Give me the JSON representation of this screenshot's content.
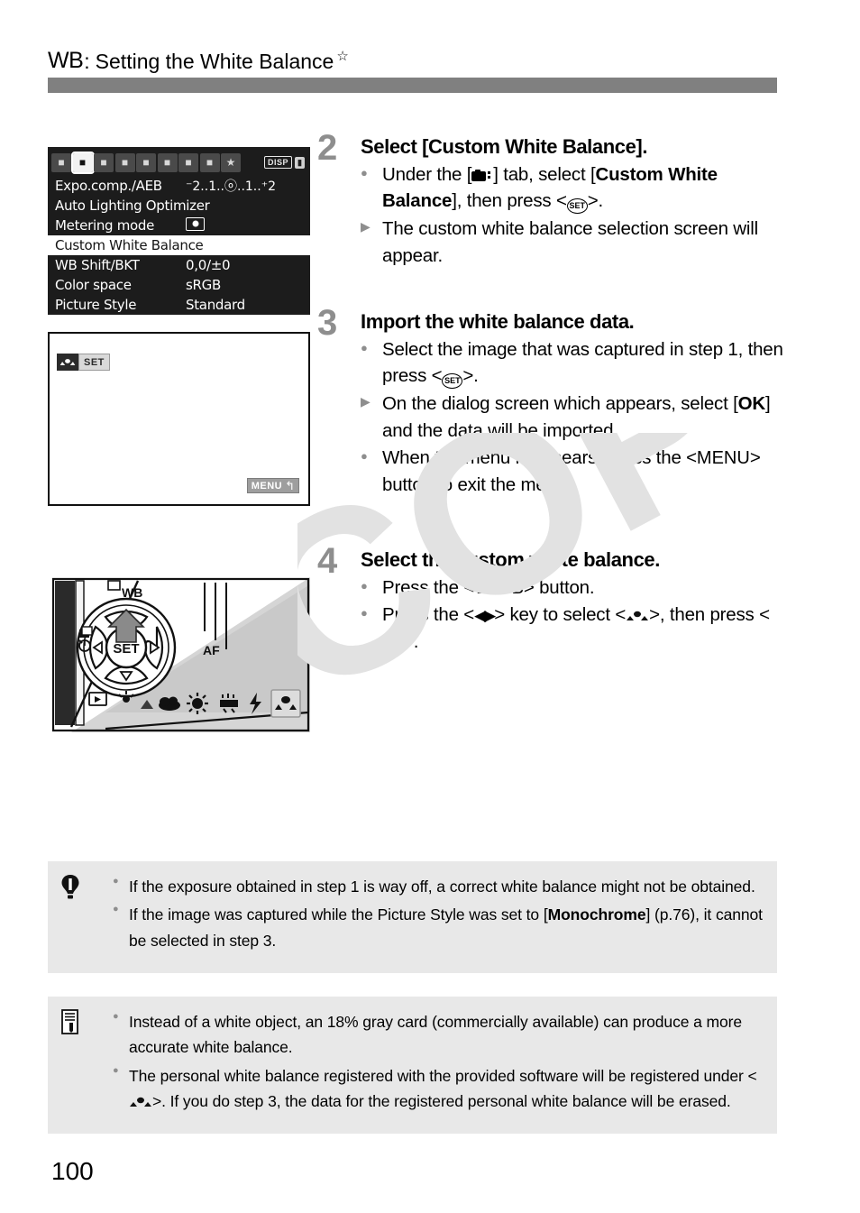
{
  "header": {
    "wb_symbol": "WB",
    "colon": ":",
    "title": "Setting the White Balance",
    "star": "☆",
    "bar_color": "#808080"
  },
  "menu_figure": {
    "name": "camera-menu-screenshot",
    "tabs": [
      {
        "name": "shoot-tab-1",
        "glyph": "■",
        "active": false
      },
      {
        "name": "shoot-tab-2",
        "glyph": "■",
        "active": true
      },
      {
        "name": "shoot-tab-3",
        "glyph": "■",
        "active": false
      },
      {
        "name": "playback-tab-1",
        "glyph": "■",
        "active": false
      },
      {
        "name": "playback-tab-2",
        "glyph": "■",
        "active": false
      },
      {
        "name": "setup-tab-1",
        "glyph": "■",
        "active": false
      },
      {
        "name": "setup-tab-2",
        "glyph": "■",
        "active": false
      },
      {
        "name": "setup-tab-3",
        "glyph": "■",
        "active": false
      },
      {
        "name": "my-menu-tab",
        "glyph": "★",
        "active": false
      }
    ],
    "disp_badge": "DISP",
    "lv_badge": "⬛",
    "rows": [
      {
        "label": "Expo.comp./AEB",
        "value": "⁻2..1..ⓞ..1..⁺2",
        "type": "scale",
        "selected": false
      },
      {
        "label": "Auto Lighting Optimizer",
        "value": "",
        "type": "plain",
        "selected": false
      },
      {
        "label": "Metering mode",
        "value": "",
        "type": "metering",
        "selected": false
      },
      {
        "label": "Custom White Balance",
        "value": "",
        "type": "plain",
        "selected": true
      },
      {
        "label": "WB Shift/BKT",
        "value": "0,0/±0",
        "type": "plain",
        "selected": false
      },
      {
        "label": "Color space",
        "value": "sRGB",
        "type": "plain",
        "selected": false
      },
      {
        "label": "Picture Style",
        "value": "Standard",
        "type": "plain",
        "selected": false
      }
    ]
  },
  "screen_figure": {
    "name": "custom-wb-selection-screen",
    "set_badge": "SET",
    "menu_badge": "MENU",
    "return_glyph": "↰"
  },
  "camera_figure": {
    "name": "camera-back-controls-diagram",
    "wb_label": "WB",
    "af_label": "AF",
    "set_label": "SET",
    "wb_icons": [
      {
        "name": "wb-shade-icon"
      },
      {
        "name": "wb-cloudy-icon"
      },
      {
        "name": "wb-daylight-icon"
      },
      {
        "name": "wb-tungsten-icon"
      },
      {
        "name": "wb-flash-icon"
      },
      {
        "name": "wb-custom-icon",
        "selected": true
      }
    ]
  },
  "steps": [
    {
      "number": "2",
      "title": "Select [Custom White Balance].",
      "bullets": [
        {
          "mark": "dot",
          "segments": [
            {
              "t": "Under the [",
              "b": false
            },
            {
              "t": "@CAMTAB@",
              "b": false
            },
            {
              "t": "] tab, select [",
              "b": false
            },
            {
              "t": "Custom White Balance",
              "b": true
            },
            {
              "t": "], then press <",
              "b": false
            },
            {
              "t": "@SET@",
              "b": false
            },
            {
              "t": ">.",
              "b": false
            }
          ]
        },
        {
          "mark": "tri",
          "segments": [
            {
              "t": "The custom white balance selection screen will appear.",
              "b": false
            }
          ]
        }
      ]
    },
    {
      "number": "3",
      "title": "Import the white balance data.",
      "bullets": [
        {
          "mark": "dot",
          "segments": [
            {
              "t": "Select the image that was captured in step 1, then press <",
              "b": false
            },
            {
              "t": "@SET@",
              "b": false
            },
            {
              "t": ">.",
              "b": false
            }
          ]
        },
        {
          "mark": "tri",
          "segments": [
            {
              "t": "On the dialog screen which appears, select [",
              "b": false
            },
            {
              "t": "OK",
              "b": true
            },
            {
              "t": "] and the data will be imported.",
              "b": false
            }
          ]
        },
        {
          "mark": "dot",
          "segments": [
            {
              "t": "When the menu reappears, press the <",
              "b": false
            },
            {
              "t": "@MENU@",
              "b": false
            },
            {
              "t": "> button to exit the menu.",
              "b": false
            }
          ]
        }
      ]
    },
    {
      "number": "4",
      "title": "Select the custom white balance.",
      "bullets": [
        {
          "mark": "dot",
          "segments": [
            {
              "t": "Press the <",
              "b": false
            },
            {
              "t": "@UP@",
              "b": false
            },
            {
              "t": " WB> button.",
              "b": false
            }
          ]
        },
        {
          "mark": "dot",
          "segments": [
            {
              "t": "Press the <",
              "b": false
            },
            {
              "t": "@LR@",
              "b": false
            },
            {
              "t": "> key to select <",
              "b": false
            },
            {
              "t": "@WBCUSTOM@",
              "b": false
            },
            {
              "t": ">, then press <",
              "b": false
            },
            {
              "t": "@SET@",
              "b": false
            },
            {
              "t": ">.",
              "b": false
            }
          ]
        }
      ]
    }
  ],
  "notes": [
    {
      "name": "caution-note",
      "icon": "caution-icon",
      "bullets": [
        {
          "segments": [
            {
              "t": "If the exposure obtained in step 1 is way off, a correct white balance might not be obtained.",
              "b": false
            }
          ]
        },
        {
          "segments": [
            {
              "t": "If the image was captured while the Picture Style was set to [",
              "b": false
            },
            {
              "t": "Monochrome",
              "b": true
            },
            {
              "t": "] (p.76), it cannot be selected in step 3.",
              "b": false
            }
          ]
        }
      ]
    },
    {
      "name": "tip-note",
      "icon": "note-icon",
      "bullets": [
        {
          "segments": [
            {
              "t": "Instead of a white object, an 18% gray card (commercially available) can produce a more accurate white balance.",
              "b": false
            }
          ]
        },
        {
          "segments": [
            {
              "t": "The personal white balance registered with the provided software will be registered under <",
              "b": false
            },
            {
              "t": "@WBCUSTOM@",
              "b": false
            },
            {
              "t": ">. If you do step 3, the data for the registered personal white balance will be erased.",
              "b": false
            }
          ]
        }
      ]
    }
  ],
  "page_number": "100",
  "watermark_text": "COPY"
}
